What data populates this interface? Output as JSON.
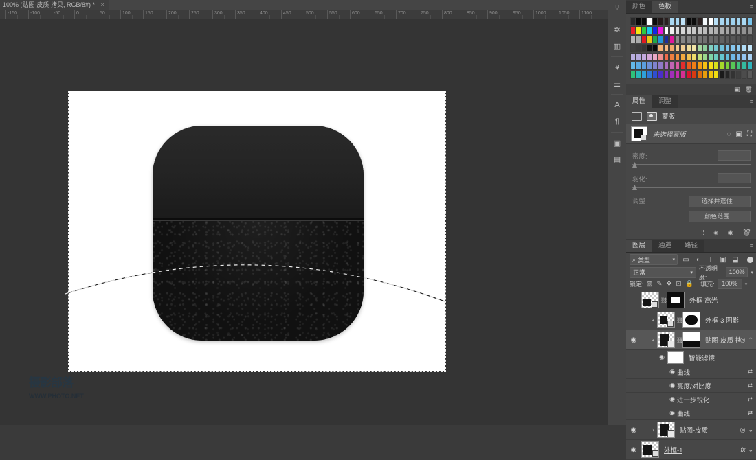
{
  "document": {
    "tab_title": "100% (贴图-皮质 拷贝, RGB/8#) *",
    "close_label": "×"
  },
  "ruler": {
    "unit_labels": [
      "-150",
      "-100",
      "-50",
      "0",
      "50",
      "100",
      "150",
      "200",
      "250",
      "300",
      "350",
      "400",
      "450",
      "500",
      "550",
      "600",
      "650",
      "700",
      "750",
      "800",
      "850",
      "900",
      "950",
      "1000",
      "1050",
      "1100"
    ],
    "origin_label": "0"
  },
  "canvas": {
    "watermark_line1": "摄影部落",
    "watermark_line2": "WWW.PHOTO.NET",
    "selection_label": "marching-ants-selection"
  },
  "icon_dock": {
    "items": [
      {
        "name": "history-brush-icon",
        "glyph": "⑂"
      },
      {
        "name": "adjustments-icon",
        "glyph": "✲"
      },
      {
        "name": "libraries-icon",
        "glyph": "▥"
      },
      {
        "name": "styles-icon",
        "glyph": "⚘"
      },
      {
        "name": "actions-icon",
        "glyph": "⚌"
      },
      {
        "name": "character-icon",
        "glyph": "A"
      },
      {
        "name": "paragraph-icon",
        "glyph": "¶"
      },
      {
        "name": "history-icon",
        "glyph": "▣"
      },
      {
        "name": "notes-icon",
        "glyph": "▤"
      }
    ]
  },
  "swatches_panel": {
    "tabs": [
      {
        "label": "颜色",
        "active": false
      },
      {
        "label": "色板",
        "active": true
      }
    ],
    "menu_glyph": "≡",
    "rows": [
      [
        "#2a2a2a",
        "#0a0a0a",
        "#0b0b0b",
        "#ffffff",
        "#0c0c0c",
        "#241a1a",
        "#2b2020",
        "#a9d8f2",
        "#a9d8f2",
        "#bfe2f7",
        "#0a0a0a",
        "#0d0d0d",
        "#2a1f1f",
        "#f4f9fc",
        "#ffffff",
        "#b9e0f6",
        "#a7d6f1",
        "#a2d4f0",
        "#9fd2ef",
        "#a4d5f0",
        "#a9d8f2",
        "#79c4ec"
      ],
      [
        "#ea2027",
        "#f5e612",
        "#2ecc40",
        "#19c8e8",
        "#1226ea",
        "#ea18dc",
        "#ffffff",
        "#efefef",
        "#dcdcdc",
        "#d6d6d6",
        "#cfcfcf",
        "#c8c8c8",
        "#c2c2c2",
        "#bcbcbc",
        "#b6b6b6",
        "#b0b0b0",
        "#aaaaaa",
        "#a4a4a4",
        "#9e9e9e",
        "#989898",
        "#929292",
        "#8d8d8d"
      ],
      [
        "#b4b4b4",
        "#aaaaaa",
        "#e21b22",
        "#eac713",
        "#20a84a",
        "#2196d9",
        "#1b2e9c",
        "#e0179c",
        "#8b8b8b",
        "#868686",
        "#818181",
        "#7b7b7b",
        "#767676",
        "#717171",
        "#6b6b6b",
        "#666666",
        "#616161",
        "#5c5c5c",
        "#575757",
        "#525252",
        "#4d4d4d",
        "#484848"
      ],
      [
        "#3f3f3f",
        "#3a3a3a",
        "#353535",
        "#141414",
        "#0c0c0c",
        "#f2b276",
        "#f3b87f",
        "#f1a86a",
        "#efc98e",
        "#f0cd93",
        "#eedc9b",
        "#f0e4a6",
        "#a7d7a0",
        "#8ecf9c",
        "#7fcfc0",
        "#74c7cf",
        "#6fbfd8",
        "#79c0e6",
        "#86c7ee",
        "#8fcdf2",
        "#b0dcf6",
        "#c2e4f8"
      ],
      [
        "#b9aee0",
        "#b5a9dd",
        "#c2a9de",
        "#d2a5d6",
        "#eaa8c6",
        "#ef8f8f",
        "#f06a4b",
        "#ee7f3f",
        "#f0923f",
        "#f3a93f",
        "#f1c252",
        "#eedc6a",
        "#c2e07a",
        "#9ad98c",
        "#7fd4a6",
        "#6dcdbf",
        "#64c6cf",
        "#63bcda",
        "#6fb7e6",
        "#7fb9ec",
        "#93c4f0",
        "#a8d0f3"
      ],
      [
        "#63b9ea",
        "#5aabe4",
        "#5b9ede",
        "#6e8fd6",
        "#7f83cf",
        "#8f7ac8",
        "#a86fc0",
        "#c164b3",
        "#d95aa3",
        "#e42e2e",
        "#ea5a1d",
        "#ef7d16",
        "#f39b12",
        "#f6c012",
        "#f7e018",
        "#d7e01c",
        "#a6d82a",
        "#7bcf3a",
        "#58c656",
        "#40bf7c",
        "#34b99f",
        "#2fb3bb"
      ],
      [
        "#2ec27a",
        "#28b7b7",
        "#2fa0da",
        "#2f78d6",
        "#2f4fd0",
        "#4a2fc8",
        "#7a2fc2",
        "#a12fba",
        "#c42fae",
        "#d42f92",
        "#d8152f",
        "#d83a12",
        "#dd6c0c",
        "#e89c0b",
        "#f2c40b",
        "#f0dd12",
        "#1a1a1a",
        "#262626",
        "#333333",
        "#3f3f3f",
        "#4c4c4c",
        "#595959"
      ]
    ],
    "footer_icons": [
      {
        "name": "new-swatch-icon",
        "glyph": "▣"
      },
      {
        "name": "delete-swatch-icon",
        "glyph": "🗑"
      }
    ]
  },
  "properties_panel": {
    "tabs": [
      {
        "label": "属性",
        "active": true
      },
      {
        "label": "调整",
        "active": false
      }
    ],
    "menu_glyph": "≡",
    "kind_label": "蒙版",
    "kind_icons": [
      {
        "name": "pixel-mask-icon",
        "glyph": "▤"
      },
      {
        "name": "vector-mask-icon",
        "glyph": "▣"
      }
    ],
    "mask_status": "未选择蒙版",
    "mask_row_icons": [
      {
        "name": "load-selection-icon",
        "glyph": "◌"
      },
      {
        "name": "apply-mask-icon",
        "glyph": "▣"
      },
      {
        "name": "disable-mask-icon",
        "glyph": "⛶"
      }
    ],
    "density": {
      "label": "密度:",
      "value": ""
    },
    "feather": {
      "label": "羽化:",
      "value": ""
    },
    "refine": {
      "label": "调整:",
      "buttons": [
        "选择并遮住...",
        "颜色范围..."
      ]
    },
    "footer_icons": [
      {
        "name": "mask-options-icon",
        "glyph": "⦙⦙"
      },
      {
        "name": "invert-mask-icon",
        "glyph": "◈"
      },
      {
        "name": "toggle-mask-icon",
        "glyph": "◉"
      },
      {
        "name": "delete-mask-icon",
        "glyph": "🗑"
      }
    ]
  },
  "layers_panel": {
    "tabs": [
      {
        "label": "图层",
        "active": true
      },
      {
        "label": "通道",
        "active": false
      },
      {
        "label": "路径",
        "active": false
      }
    ],
    "menu_glyph": "≡",
    "filter": {
      "search_icon": "⌕",
      "kind_label": "类型",
      "chevron": "▾",
      "type_icons": [
        {
          "name": "filter-pixel-icon",
          "glyph": "▭"
        },
        {
          "name": "filter-adjustment-icon",
          "glyph": "◐"
        },
        {
          "name": "filter-type-icon",
          "glyph": "T"
        },
        {
          "name": "filter-shape-icon",
          "glyph": "▣"
        },
        {
          "name": "filter-smart-icon",
          "glyph": "⬓"
        }
      ],
      "power_toggle": "●"
    },
    "blend": {
      "mode": "正常",
      "chevron": "▾",
      "opacity_label": "不透明度:",
      "opacity_value": "100%",
      "opacity_chevron": "▾"
    },
    "lock": {
      "label": "锁定:",
      "icons": [
        {
          "name": "lock-transparency-icon",
          "glyph": "▨"
        },
        {
          "name": "lock-image-icon",
          "glyph": "✎"
        },
        {
          "name": "lock-position-icon",
          "glyph": "✥"
        },
        {
          "name": "lock-artboard-icon",
          "glyph": "⊡"
        },
        {
          "name": "lock-all-icon",
          "glyph": "🔒"
        }
      ],
      "fill_label": "填充:",
      "fill_value": "100%",
      "fill_chevron": "▾"
    },
    "layers": [
      {
        "name": "外框-高光",
        "visible": false,
        "selected": false,
        "indent": 0,
        "has_mask": true,
        "smart": false,
        "right_icons": []
      },
      {
        "name": "外框-3 阴影",
        "visible": false,
        "selected": false,
        "indent": 1,
        "has_mask": true,
        "smart": false,
        "right_icons": []
      },
      {
        "name": "贴图-皮质 拷贝",
        "visible": true,
        "selected": true,
        "indent": 1,
        "has_mask": true,
        "smart": true,
        "right_icons": [
          "◎",
          "⌃"
        ]
      }
    ],
    "smart_filters": {
      "label": "智能滤镜",
      "eye": "◉",
      "items": [
        {
          "name": "曲线",
          "eye": "◉",
          "options": "⇄"
        },
        {
          "name": "亮度/对比度",
          "eye": "◉",
          "options": "⇄"
        },
        {
          "name": "进一步锐化",
          "eye": "◉",
          "options": "⇄"
        },
        {
          "name": "曲线",
          "eye": "◉",
          "options": "⇄"
        }
      ]
    },
    "bottom_layers": [
      {
        "name": "贴图-皮质",
        "visible": true,
        "selected": false,
        "indent": 1,
        "smart": true,
        "right_icons": [
          "◎",
          "⌄"
        ]
      },
      {
        "name": "外框-1",
        "visible": true,
        "selected": false,
        "indent": 0,
        "smart": false,
        "underline": true,
        "right_icons": [
          "fx",
          "⌄"
        ]
      }
    ]
  },
  "colors": {
    "app_bg": "#3a3a3a",
    "panel_bg": "#474747",
    "canvas_bg": "#343434",
    "selected_row": "#575757",
    "text": "#d0d0d0"
  }
}
